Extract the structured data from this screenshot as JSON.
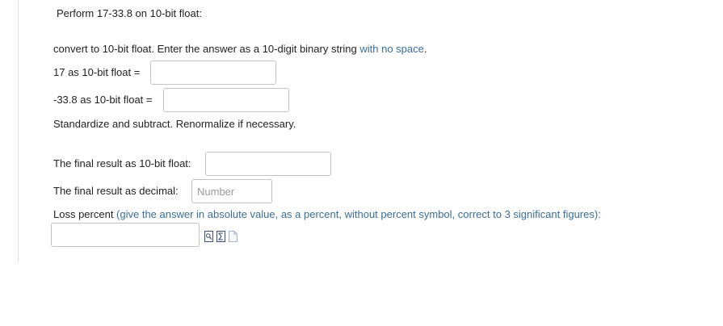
{
  "question": {
    "title": "Perform 17-33.8 on 10-bit float:",
    "instruction_text": "convert to 10-bit float. Enter the answer as a 10-digit binary string ",
    "instruction_hint": "with no space",
    "instruction_end": ".",
    "label_17": "17 as 10-bit float =",
    "value_17": "",
    "label_neg338": "-33.8 as 10-bit float =",
    "value_neg338": "",
    "standardize_text": "Standardize and subtract. Renormalize if necessary.",
    "label_final_float": "The final result as 10-bit float:",
    "value_final_float": "",
    "label_final_decimal": "The final result as decimal:",
    "final_decimal_placeholder": "Number",
    "value_final_decimal": "",
    "label_loss": "Loss percent ",
    "loss_hint": "(give the answer in absolute value, as a percent, without percent symbol, correct to 3 significant figures)",
    "loss_end": ":",
    "value_loss": ""
  },
  "toolbar": {
    "icons": [
      "preview-icon",
      "equation-icon",
      "blank-document-icon"
    ]
  },
  "colors": {
    "hint": "#3a6e9a",
    "text": "#222222",
    "border": "#c4c4c4"
  }
}
